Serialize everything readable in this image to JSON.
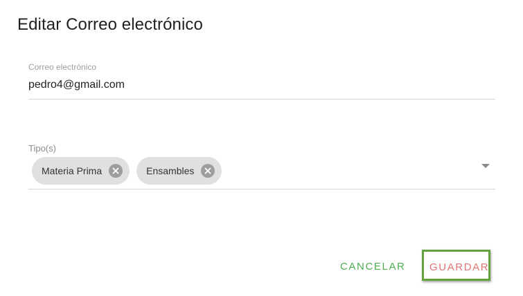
{
  "dialog": {
    "title": "Editar Correo electrónico"
  },
  "email_field": {
    "label": "Correo electrónico",
    "value": "pedro4@gmail.com"
  },
  "tipos_field": {
    "label": "Tipo(s)",
    "chips": [
      {
        "label": "Materia Prima",
        "icon": "close-circle-icon"
      },
      {
        "label": "Ensambles",
        "icon": "close-circle-icon"
      }
    ],
    "dropdown_icon": "chevron-down-icon"
  },
  "actions": {
    "cancel_label": "CANCELAR",
    "save_label": "GUARDAR"
  },
  "colors": {
    "cancel": "#4caf50",
    "save": "#e57373",
    "highlight_border": "#62a33a"
  }
}
